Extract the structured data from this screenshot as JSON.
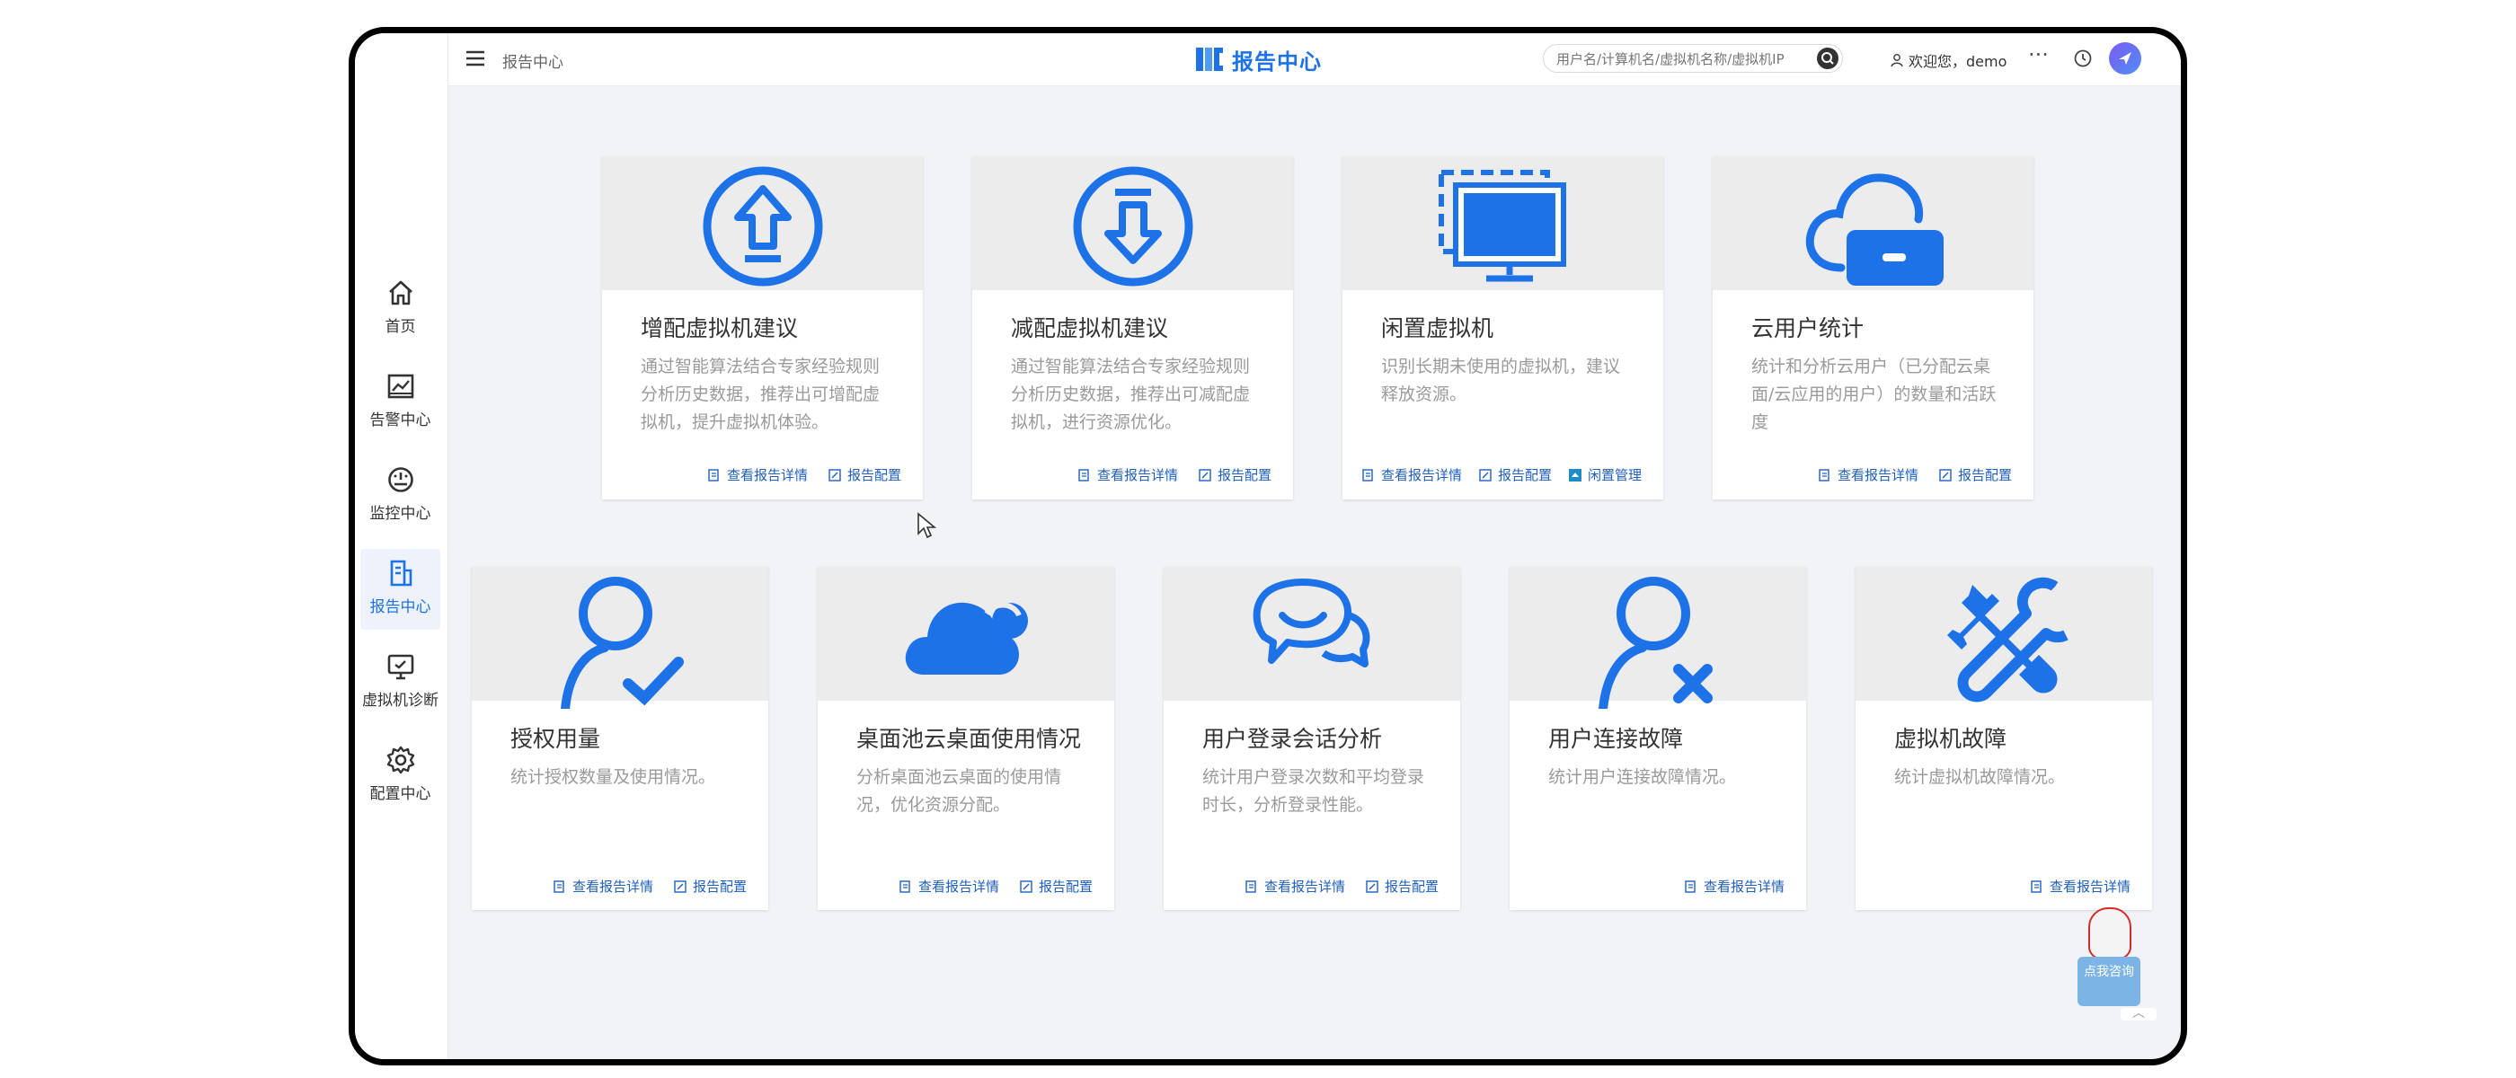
{
  "header": {
    "breadcrumb": "报告中心",
    "title": "报告中心",
    "search_placeholder": "用户名/计算机名/虚拟机名称/虚拟机IP",
    "welcome": "欢迎您，demo",
    "more": "···"
  },
  "sidebar": {
    "items": [
      {
        "label": "首页",
        "icon": "home-icon"
      },
      {
        "label": "告警中心",
        "icon": "alarm-chart-icon"
      },
      {
        "label": "监控中心",
        "icon": "gauge-icon"
      },
      {
        "label": "报告中心",
        "icon": "report-icon",
        "active": true
      },
      {
        "label": "虚拟机诊断",
        "icon": "vm-diagnosis-icon"
      },
      {
        "label": "配置中心",
        "icon": "gear-icon"
      }
    ]
  },
  "cards": [
    {
      "title": "增配虚拟机建议",
      "desc": "通过智能算法结合专家经验规则分析历史数据，推荐出可增配虚拟机，提升虚拟机体验。",
      "icon": "arrow-up-circle-icon",
      "links": [
        "查看报告详情",
        "报告配置"
      ]
    },
    {
      "title": "减配虚拟机建议",
      "desc": "通过智能算法结合专家经验规则分析历史数据，推荐出可减配虚拟机，进行资源优化。",
      "icon": "arrow-down-circle-icon",
      "links": [
        "查看报告详情",
        "报告配置"
      ]
    },
    {
      "title": "闲置虚拟机",
      "desc": "识别长期未使用的虚拟机，建议释放资源。",
      "icon": "idle-monitor-icon",
      "links": [
        "查看报告详情",
        "报告配置",
        "闲置管理"
      ]
    },
    {
      "title": "云用户统计",
      "desc": "统计和分析云用户（已分配云桌面/云应用的用户）的数量和活跃度",
      "icon": "cloud-user-icon",
      "links": [
        "查看报告详情",
        "报告配置"
      ]
    },
    {
      "title": "授权用量",
      "desc": "统计授权数量及使用情况。",
      "icon": "user-check-icon",
      "links": [
        "查看报告详情",
        "报告配置"
      ]
    },
    {
      "title": "桌面池云桌面使用情况",
      "desc": "分析桌面池云桌面的使用情况，优化资源分配。",
      "icon": "cloud-icon",
      "links": [
        "查看报告详情",
        "报告配置"
      ]
    },
    {
      "title": "用户登录会话分析",
      "desc": "统计用户登录次数和平均登录时长，分析登录性能。",
      "icon": "chat-bubbles-icon",
      "links": [
        "查看报告详情",
        "报告配置"
      ]
    },
    {
      "title": "用户连接故障",
      "desc": "统计用户连接故障情况。",
      "icon": "user-x-icon",
      "links": [
        "查看报告详情"
      ]
    },
    {
      "title": "虚拟机故障",
      "desc": "统计虚拟机故障情况。",
      "icon": "tools-icon",
      "links": [
        "查看报告详情"
      ]
    }
  ],
  "assistant": {
    "label": "点我咨询"
  },
  "colors": {
    "accent": "#1d72e8",
    "link": "#1f5fbf",
    "background": "#f2f3f7"
  }
}
